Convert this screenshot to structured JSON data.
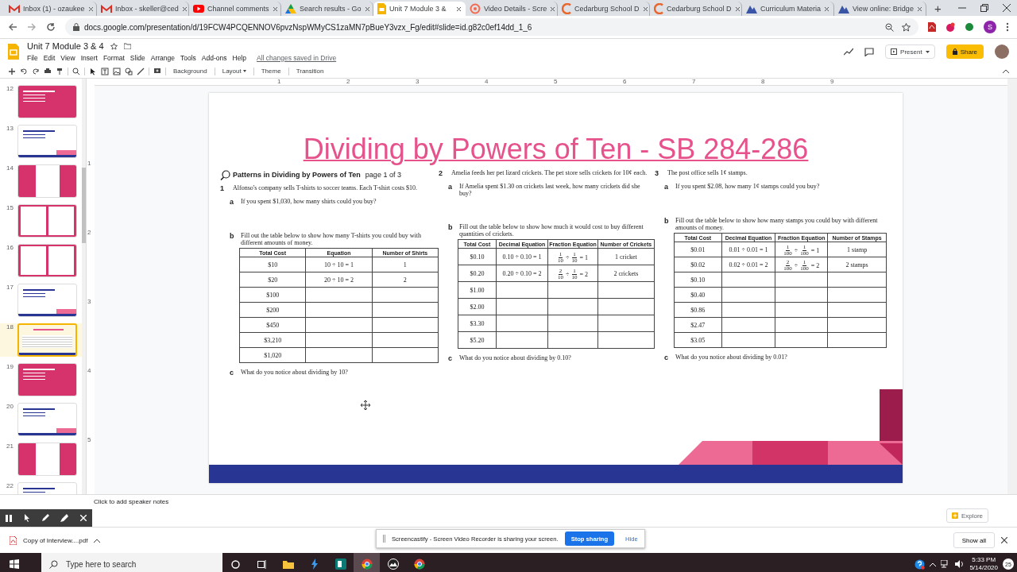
{
  "browser": {
    "tabs": [
      {
        "title": "Inbox (1) - ozaukee",
        "selected": false
      },
      {
        "title": "Inbox - skeller@ced",
        "selected": false
      },
      {
        "title": "Channel comments",
        "selected": false
      },
      {
        "title": "Search results - Go",
        "selected": false
      },
      {
        "title": "Unit 7 Module 3 &",
        "selected": true
      },
      {
        "title": "Video Details - Scre",
        "selected": false
      },
      {
        "title": "Cedarburg School D",
        "selected": false
      },
      {
        "title": "Cedarburg School D",
        "selected": false
      },
      {
        "title": "Curriculum Materia",
        "selected": false
      },
      {
        "title": "View online: Bridge",
        "selected": false
      }
    ],
    "new_tab": "+",
    "address": "docs.google.com/presentation/d/19FCW4PCQENNOV6pvzNspWMyCS1zaMN7pBueY3vzx_Fg/edit#slide=id.g82c0ef14dd_1_6",
    "profile_initial": "S"
  },
  "document": {
    "title": "Unit 7 Module 3 & 4",
    "menus": [
      "File",
      "Edit",
      "View",
      "Insert",
      "Format",
      "Slide",
      "Arrange",
      "Tools",
      "Add-ons",
      "Help"
    ],
    "save_status": "All changes saved in Drive",
    "present": "Present",
    "share": "Share"
  },
  "toolbar": {
    "buttons": [
      {
        "label": "Background",
        "kind": "plain"
      },
      {
        "label": "Layout",
        "kind": "dropdown"
      },
      {
        "label": "Theme",
        "kind": "plain"
      },
      {
        "label": "Transition",
        "kind": "plain"
      }
    ]
  },
  "ruler": {
    "horizontal": [
      "1",
      "2",
      "3",
      "4",
      "5",
      "6",
      "7",
      "8",
      "9"
    ],
    "vertical": [
      "1",
      "2",
      "3",
      "4",
      "5"
    ]
  },
  "filmstrip": [
    {
      "number": "12",
      "kind": "pink",
      "selected": false
    },
    {
      "number": "13",
      "kind": "white",
      "selected": false
    },
    {
      "number": "14",
      "kind": "sheet",
      "selected": false
    },
    {
      "number": "15",
      "kind": "sheets",
      "selected": false
    },
    {
      "number": "16",
      "kind": "sheets",
      "selected": false
    },
    {
      "number": "17",
      "kind": "white",
      "selected": false
    },
    {
      "number": "18",
      "kind": "current",
      "selected": true
    },
    {
      "number": "19",
      "kind": "pink",
      "selected": false
    },
    {
      "number": "20",
      "kind": "white",
      "selected": false
    },
    {
      "number": "21",
      "kind": "sheet",
      "selected": false
    },
    {
      "number": "22",
      "kind": "white",
      "selected": false
    }
  ],
  "slide": {
    "title": "Dividing by Powers of Ten - SB 284-286",
    "heading": {
      "title": "Patterns in Dividing by Powers of Ten",
      "page": "page 1 of 3"
    },
    "problems": [
      {
        "number": "1",
        "text": "Alfonso's company sells T-shirts to soccer teams. Each T-shirt costs $10.",
        "parts": [
          {
            "letter": "a",
            "text": "If you spent $1,030, how many shirts could you buy?"
          },
          {
            "letter": "b",
            "text": "Fill out the table below to show how many T-shirts you could buy with different amounts of money.",
            "table": {
              "columns": [
                "Total Cost",
                "Equation",
                "Number of Shirts"
              ],
              "rows": [
                [
                  "$10",
                  "10 ÷ 10 = 1",
                  "1"
                ],
                [
                  "$20",
                  "20 ÷ 10 = 2",
                  "2"
                ],
                [
                  "$100",
                  "",
                  ""
                ],
                [
                  "$200",
                  "",
                  ""
                ],
                [
                  "$450",
                  "",
                  ""
                ],
                [
                  "$3,210",
                  "",
                  ""
                ],
                [
                  "$1,020",
                  "",
                  ""
                ]
              ]
            }
          },
          {
            "letter": "c",
            "text": "What do you notice about dividing by 10?"
          }
        ]
      },
      {
        "number": "2",
        "text": "Amelia feeds her pet lizard crickets. The pet store sells crickets for 10¢ each.",
        "parts": [
          {
            "letter": "a",
            "text": "If Amelia spent $1.30 on crickets last week, how many crickets did she buy?"
          },
          {
            "letter": "b",
            "text": "Fill out the table below to show how much it would cost to buy different quantities of crickets.",
            "table": {
              "columns": [
                "Total Cost",
                "Decimal Equation",
                "Fraction Equation",
                "Number of Crickets"
              ],
              "rows": [
                [
                  "$0.10",
                  "0.10 ÷ 0.10 = 1",
                  {
                    "terms": [
                      {
                        "num": "1",
                        "den": "10"
                      },
                      {
                        "num": "1",
                        "den": "10"
                      }
                    ],
                    "operator": "÷",
                    "result": "= 1"
                  },
                  "1 cricket"
                ],
                [
                  "$0.20",
                  "0.20 ÷ 0.10 = 2",
                  {
                    "terms": [
                      {
                        "num": "2",
                        "den": "10"
                      },
                      {
                        "num": "1",
                        "den": "10"
                      }
                    ],
                    "operator": "÷",
                    "result": "= 2"
                  },
                  "2 crickets"
                ],
                [
                  "$1.00",
                  "",
                  "",
                  ""
                ],
                [
                  "$2.00",
                  "",
                  "",
                  ""
                ],
                [
                  "$3.30",
                  "",
                  "",
                  ""
                ],
                [
                  "$5.20",
                  "",
                  "",
                  ""
                ]
              ]
            }
          },
          {
            "letter": "c",
            "text": "What do you notice about dividing by 0.10?"
          }
        ]
      },
      {
        "number": "3",
        "text": "The post office sells 1¢ stamps.",
        "parts": [
          {
            "letter": "a",
            "text": "If you spent $2.08, how many 1¢ stamps could you buy?"
          },
          {
            "letter": "b",
            "text": "Fill out the table below to show how many stamps you could buy with different amounts of money.",
            "table": {
              "columns": [
                "Total Cost",
                "Decimal Equation",
                "Fraction Equation",
                "Number of Stamps"
              ],
              "rows": [
                [
                  "$0.01",
                  "0.01 ÷ 0.01 = 1",
                  {
                    "terms": [
                      {
                        "num": "1",
                        "den": "100"
                      },
                      {
                        "num": "1",
                        "den": "100"
                      }
                    ],
                    "operator": "÷",
                    "result": "= 1"
                  },
                  "1 stamp"
                ],
                [
                  "$0.02",
                  "0.02 ÷ 0.01 = 2",
                  {
                    "terms": [
                      {
                        "num": "2",
                        "den": "100"
                      },
                      {
                        "num": "1",
                        "den": "100"
                      }
                    ],
                    "operator": "÷",
                    "result": "= 2"
                  },
                  "2 stamps"
                ],
                [
                  "$0.10",
                  "",
                  "",
                  ""
                ],
                [
                  "$0.40",
                  "",
                  "",
                  ""
                ],
                [
                  "$0.86",
                  "",
                  "",
                  ""
                ],
                [
                  "$2.47",
                  "",
                  "",
                  ""
                ],
                [
                  "$3.05",
                  "",
                  "",
                  ""
                ]
              ]
            }
          },
          {
            "letter": "c",
            "text": "What do you notice about dividing by 0.01?"
          }
        ]
      }
    ]
  },
  "speaker_notes": {
    "placeholder": "Click to add speaker notes"
  },
  "explore": "Explore",
  "downloads": {
    "file": "Copy of Interview....pdf",
    "show_all": "Show all"
  },
  "screen_share": {
    "message": "Screencastify - Screen Video Recorder is sharing your screen.",
    "stop": "Stop sharing",
    "hide": "Hide"
  },
  "taskbar": {
    "search_placeholder": "Type here to search",
    "time": "5:33 PM",
    "date": "5/14/2020",
    "notifications": "25"
  }
}
